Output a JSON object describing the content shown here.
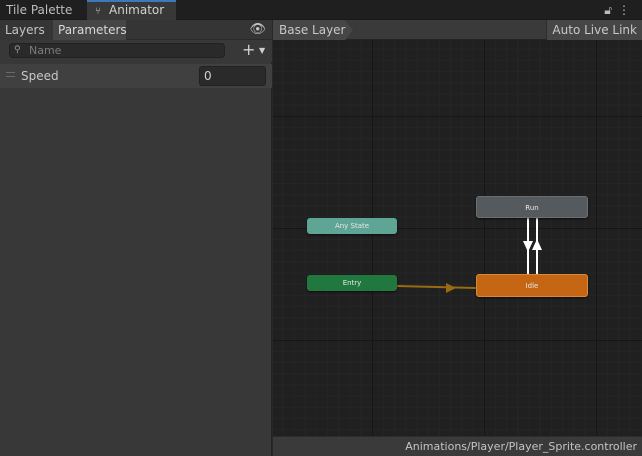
{
  "window_tabs": {
    "tile_palette": "Tile Palette",
    "animator": "Animator",
    "animator_icon": "animator-graph-icon",
    "lock_icon": "lock-icon",
    "menu_icon": "kebab-menu-icon"
  },
  "left_panel": {
    "tabs": {
      "layers": "Layers",
      "parameters": "Parameters"
    },
    "eye_icon": "eye-icon",
    "search": {
      "placeholder": "Name",
      "icon": "search-icon"
    },
    "add_button": "+",
    "parameters": [
      {
        "name": "Speed",
        "value": "0"
      }
    ]
  },
  "graph": {
    "breadcrumb": "Base Layer",
    "auto_live_link": "Auto Live Link",
    "status_path": "Animations/Player/Player_Sprite.controller",
    "nodes": {
      "any_state": "Any State",
      "entry": "Entry",
      "run": "Run",
      "idle": "Idle"
    },
    "colors": {
      "any_state": "#5ea596",
      "entry": "#21783e",
      "run": "#555a5e",
      "idle": "#c46613",
      "entry_transition": "#9a6a12",
      "state_transition": "#ffffff"
    }
  }
}
